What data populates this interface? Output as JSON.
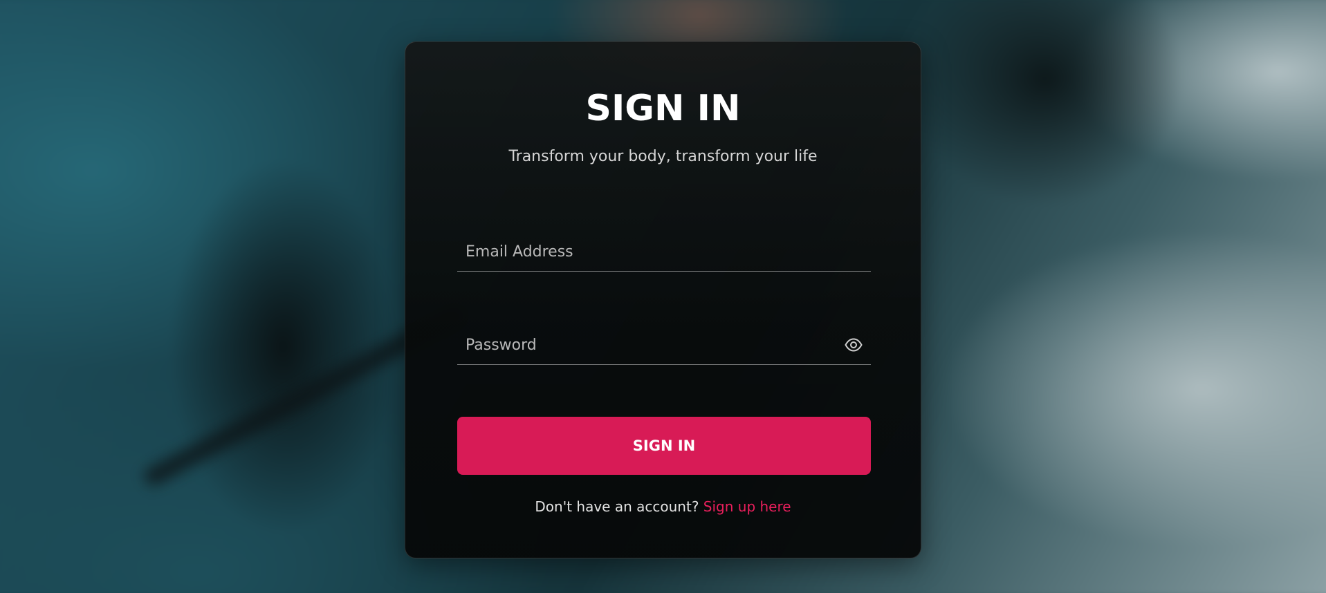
{
  "background": {
    "accent_color": "#1f5260"
  },
  "card": {
    "title": "SIGN IN",
    "subtitle": "Transform your body, transform your life"
  },
  "form": {
    "email": {
      "placeholder": "Email Address",
      "value": ""
    },
    "password": {
      "placeholder": "Password",
      "value": "",
      "toggle_icon": "eye-icon"
    },
    "submit_label": "SIGN IN",
    "submit_color": "#d81b56"
  },
  "footer": {
    "prompt": "Don't have an account?",
    "link_label": "Sign up here",
    "link_color": "#e91f5c"
  }
}
